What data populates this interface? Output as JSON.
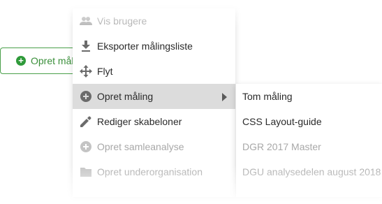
{
  "background_button": {
    "label": "Opret måling",
    "icon": "plus-circle-icon",
    "accent": "#2f9a3a"
  },
  "menu": {
    "items": [
      {
        "label": "Vis brugere",
        "icon": "users-icon",
        "disabled": true
      },
      {
        "label": "Eksporter målingsliste",
        "icon": "download-icon",
        "disabled": false
      },
      {
        "label": "Flyt",
        "icon": "move-icon",
        "disabled": false
      },
      {
        "label": "Opret måling",
        "icon": "plus-circle-icon",
        "disabled": false,
        "active": true,
        "has_submenu": true
      },
      {
        "label": "Rediger skabeloner",
        "icon": "pencil-icon",
        "disabled": false
      },
      {
        "label": "Opret samleanalyse",
        "icon": "plus-circle-icon",
        "disabled": true
      },
      {
        "label": "Opret underorganisation",
        "icon": "folder-icon",
        "disabled": true
      }
    ],
    "active_bg": "#dcdcdc"
  },
  "submenu": {
    "items": [
      {
        "label": "Tom måling",
        "disabled": false
      },
      {
        "label": "CSS Layout-guide",
        "disabled": false
      },
      {
        "label": "DGR 2017 Master",
        "disabled": true
      },
      {
        "label": "DGU analysedelen august 2018",
        "disabled": true
      }
    ]
  }
}
